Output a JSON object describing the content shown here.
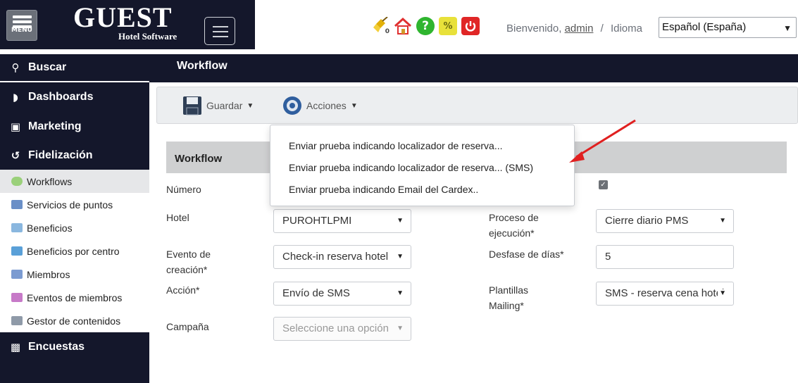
{
  "header": {
    "menu_label": "MENU",
    "logo_main": "GUEST",
    "logo_sub": "Hotel Software",
    "welcome_prefix": "Bienvenido,",
    "username": "admin",
    "separator": "/",
    "language_label": "Idioma",
    "language_value": "Español (España)",
    "icons": [
      "broom-icon",
      "home-icon",
      "help-icon",
      "loyalty-icon",
      "power-icon"
    ],
    "broom_badge": "0"
  },
  "sidebar": {
    "search": "Buscar",
    "dashboards": "Dashboards",
    "marketing": "Marketing",
    "fidelizacion": "Fidelización",
    "items": [
      {
        "label": "Workflows"
      },
      {
        "label": "Servicios de puntos"
      },
      {
        "label": "Beneficios"
      },
      {
        "label": "Beneficios por centro"
      },
      {
        "label": "Miembros"
      },
      {
        "label": "Eventos de miembros"
      },
      {
        "label": "Gestor de contenidos"
      }
    ],
    "encuestas": "Encuestas"
  },
  "main": {
    "title": "Workflow",
    "toolbar": {
      "save_label": "Guardar",
      "actions_label": "Acciones"
    },
    "panel_title": "Workflow",
    "form": {
      "numero_label": "Número",
      "hotel_label": "Hotel",
      "hotel_value": "PUROHTLPMI",
      "evento_label_1": "Evento de",
      "evento_label_2": "creación*",
      "evento_value": "Check-in reserva hotel",
      "accion_label": "Acción*",
      "accion_value": "Envío de SMS",
      "campana_label": "Campaña",
      "campana_placeholder": "Seleccione una opción",
      "proceso_label_1": "Proceso de",
      "proceso_label_2": "ejecución*",
      "proceso_value": "Cierre diario PMS",
      "desfase_label": "Desfase de días*",
      "desfase_value": "5",
      "plantillas_label_1": "Plantillas",
      "plantillas_label_2": "Mailing*",
      "plantillas_value": "SMS - reserva cena hotel",
      "checkbox_checked": true
    },
    "actions_menu": [
      "Enviar prueba indicando localizador de reserva...",
      "Enviar prueba indicando localizador de reserva... (SMS)",
      "Enviar prueba indicando Email del Cardex.."
    ]
  },
  "colors": {
    "dark_navy": "#14172b",
    "arrow_red": "#e02020",
    "panel_gray": "#cfd0d1",
    "toolbar_gray": "#eceef0"
  }
}
